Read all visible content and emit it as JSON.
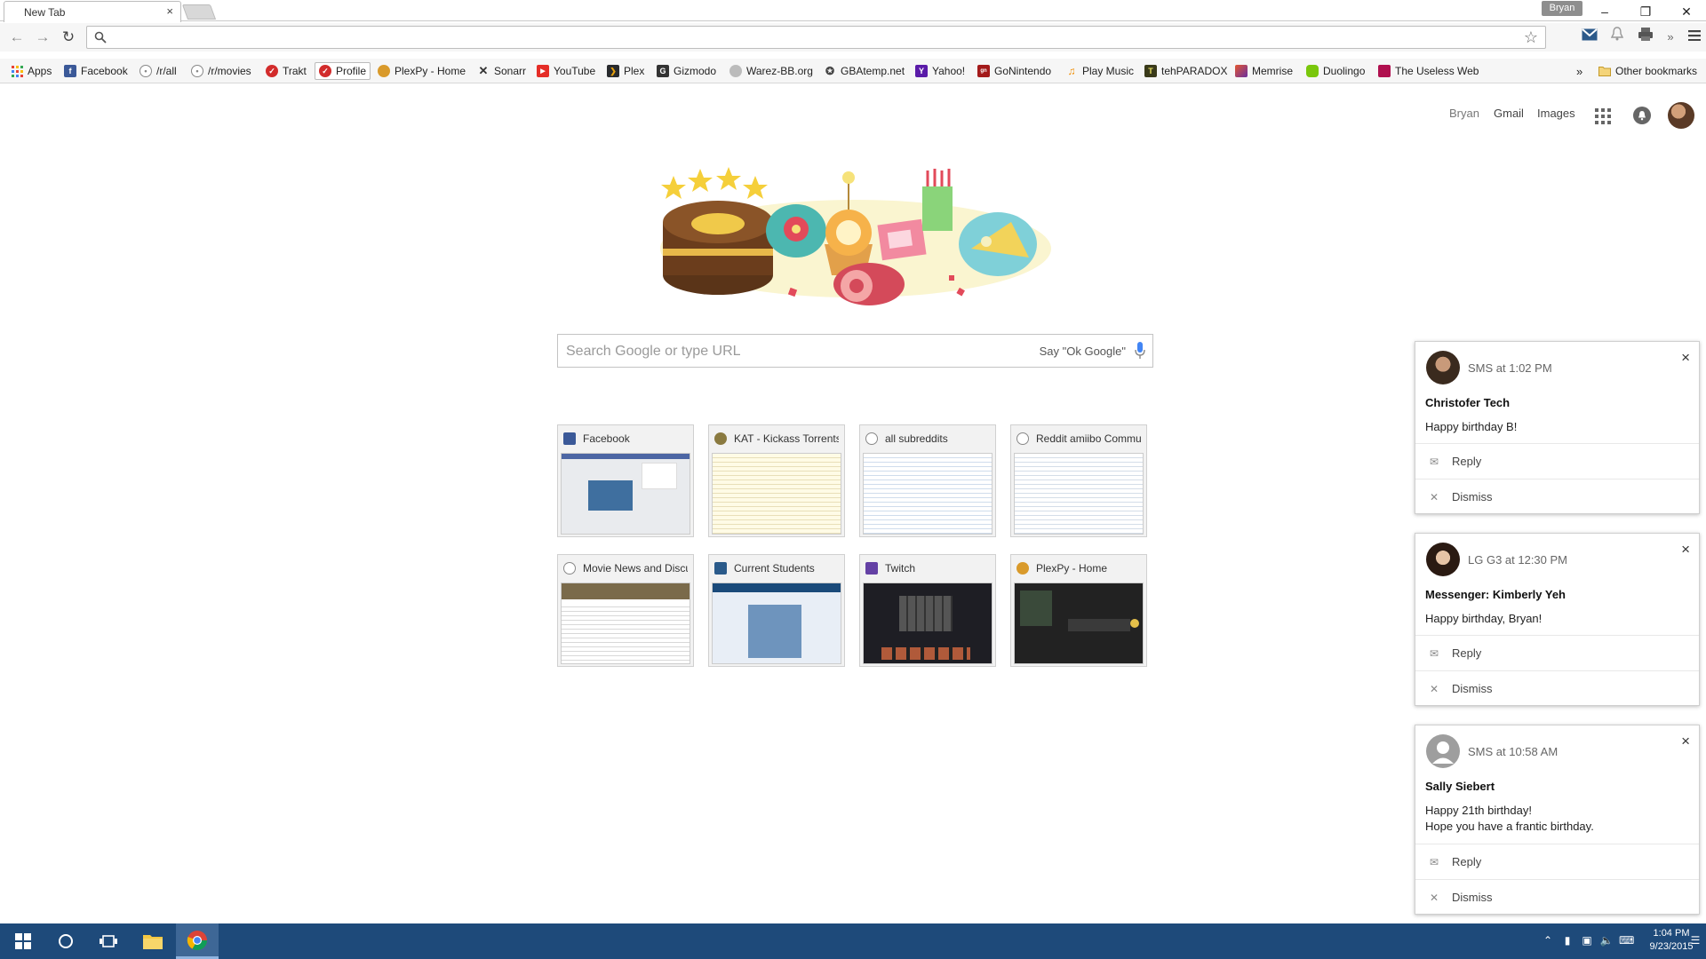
{
  "window": {
    "tab_title": "New Tab",
    "tab_close": "×",
    "profile_name": "Bryan"
  },
  "bookmarks": [
    {
      "label": "Apps",
      "icon": "apps-grid-icon",
      "color": "#dd4b39"
    },
    {
      "label": "Facebook",
      "icon": "facebook-icon",
      "color": "#3b5998"
    },
    {
      "label": "/r/all",
      "icon": "reddit-icon",
      "color": "#888888"
    },
    {
      "label": "/r/movies",
      "icon": "reddit-icon",
      "color": "#888888"
    },
    {
      "label": "Trakt",
      "icon": "trakt-icon",
      "color": "#d22b2b"
    },
    {
      "label": "Profile",
      "icon": "trakt-icon",
      "color": "#d22b2b"
    },
    {
      "label": "PlexPy - Home",
      "icon": "plexpy-icon",
      "color": "#d99a2b"
    },
    {
      "label": "Sonarr",
      "icon": "sonarr-icon",
      "color": "#333333"
    },
    {
      "label": "YouTube",
      "icon": "youtube-icon",
      "color": "#e52d27"
    },
    {
      "label": "Plex",
      "icon": "plex-icon",
      "color": "#282a2d"
    },
    {
      "label": "Gizmodo",
      "icon": "gizmodo-icon",
      "color": "#333333"
    },
    {
      "label": "Warez-BB.org",
      "icon": "warez-icon",
      "color": "#999999"
    },
    {
      "label": "GBAtemp.net",
      "icon": "gbatemp-icon",
      "color": "#444444"
    },
    {
      "label": "Yahoo!",
      "icon": "yahoo-icon",
      "color": "#5a1ba8"
    },
    {
      "label": "GoNintendo",
      "icon": "gonintendo-icon",
      "color": "#a31a1a"
    },
    {
      "label": "Play Music",
      "icon": "play-music-icon",
      "color": "#f08c00"
    },
    {
      "label": "tehPARADOX",
      "icon": "tehparadox-icon",
      "color": "#3a3a1a"
    },
    {
      "label": "Memrise",
      "icon": "memrise-icon",
      "color": "#e4562f"
    },
    {
      "label": "Duolingo",
      "icon": "duolingo-icon",
      "color": "#7ac70c"
    },
    {
      "label": "The Useless Web",
      "icon": "useless-web-icon",
      "color": "#b0104f"
    }
  ],
  "bookmarks_overflow": "»",
  "other_bookmarks": "Other bookmarks",
  "google_header": {
    "user": "Bryan",
    "gmail": "Gmail",
    "images": "Images"
  },
  "search": {
    "placeholder": "Search Google or type URL",
    "voice_hint": "Say \"Ok Google\""
  },
  "tiles": [
    {
      "title": "Facebook",
      "icon": "facebook-icon",
      "color": "#3b5998",
      "thumb": "light"
    },
    {
      "title": "KAT - Kickass Torrents",
      "icon": "kat-icon",
      "color": "#8a7a40",
      "thumb": "light"
    },
    {
      "title": "all subreddits",
      "icon": "reddit-icon",
      "color": "#888888",
      "thumb": "light"
    },
    {
      "title": "Reddit amiibo Community",
      "icon": "reddit-icon",
      "color": "#888888",
      "thumb": "light"
    },
    {
      "title": "Movie News and Discussion",
      "icon": "reddit-icon",
      "color": "#888888",
      "thumb": "light"
    },
    {
      "title": "Current Students",
      "icon": "students-icon",
      "color": "#2a5a8a",
      "thumb": "blue"
    },
    {
      "title": "Twitch",
      "icon": "twitch-icon",
      "color": "#6441a5",
      "thumb": "dark"
    },
    {
      "title": "PlexPy - Home",
      "icon": "plexpy-icon",
      "color": "#d99a2b",
      "thumb": "dark"
    }
  ],
  "notifications": [
    {
      "source": "SMS at 1:02 PM",
      "name": "Christofer Tech",
      "message": [
        "Happy birthday B!"
      ],
      "reply": "Reply",
      "dismiss": "Dismiss",
      "close": "×"
    },
    {
      "source": "LG G3 at 12:30 PM",
      "name": "Messenger: Kimberly Yeh",
      "message": [
        "Happy birthday, Bryan!"
      ],
      "reply": "Reply",
      "dismiss": "Dismiss",
      "close": "×"
    },
    {
      "source": "SMS at 10:58 AM",
      "name": "Sally Siebert",
      "message": [
        "Happy 21th birthday!",
        "Hope you have a frantic birthday."
      ],
      "reply": "Reply",
      "dismiss": "Dismiss",
      "close": "×"
    }
  ],
  "taskbar": {
    "time": "1:04 PM",
    "date": "9/23/2015"
  }
}
